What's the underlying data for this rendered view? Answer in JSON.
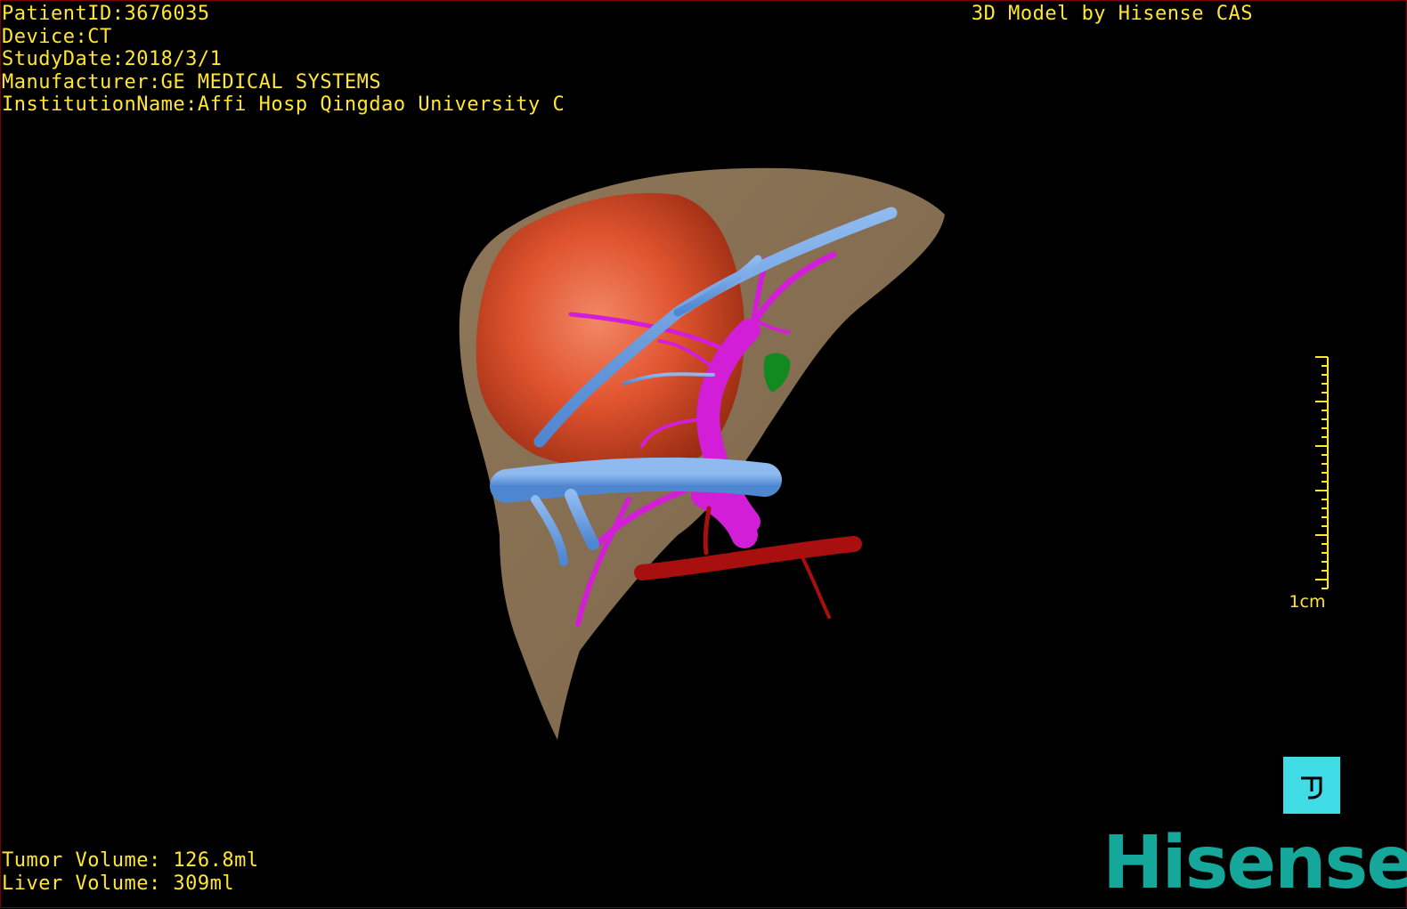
{
  "header": {
    "patient_id": "PatientID:3676035",
    "device": "Device:CT",
    "study_date": "StudyDate:2018/3/1",
    "manufacturer": "Manufacturer:GE MEDICAL SYSTEMS",
    "institution": "InstitutionName:Affi Hosp Qingdao University C",
    "caption": "3D Model by Hisense CAS"
  },
  "volumes": {
    "tumor": "Tumor Volume: 126.8ml",
    "liver": "Liver Volume: 309ml"
  },
  "scale": {
    "label": "1cm"
  },
  "logo": {
    "text": "Hisense"
  },
  "icons": {
    "view_cube": "orientation-cube-icon"
  },
  "colors": {
    "overlay_text": "#ffe633",
    "liver": "#8c7458",
    "tumor": "#e05530",
    "portal_vein": "#6a9ee0",
    "hepatic_vein": "#d31ed7",
    "artery": "#a81010",
    "lesion": "#138a20",
    "view_cube": "#41dde6",
    "logo": "#14a79a"
  }
}
